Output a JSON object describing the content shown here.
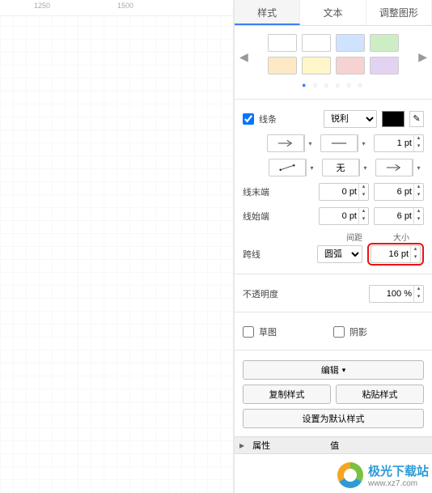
{
  "canvas": {
    "ruler_marks": [
      "1250",
      "1500"
    ]
  },
  "tabs": {
    "style": "样式",
    "text": "文本",
    "adjust": "调整图形",
    "active": "样式"
  },
  "swatches": {
    "row1": [
      "#ffffff",
      "#ffffff",
      "#cfe3ff",
      "#cdeec5"
    ],
    "row2": [
      "#fde9c4",
      "#fff6c9",
      "#f7d2d2",
      "#e3d3f2"
    ]
  },
  "line": {
    "label": "线条",
    "sharp": "锐利",
    "width_value": "1 pt",
    "style_none": "无"
  },
  "line_end": {
    "label": "线末端",
    "val1": "0 pt",
    "val2": "6 pt"
  },
  "line_start": {
    "label": "线始端",
    "val1": "0 pt",
    "val2": "6 pt"
  },
  "spacing_size": {
    "spacing": "间距",
    "size": "大小"
  },
  "cross_line": {
    "label": "跨线",
    "arc": "圆弧",
    "size": "16 pt"
  },
  "opacity": {
    "label": "不透明度",
    "value": "100 %"
  },
  "sketch": {
    "label": "草图"
  },
  "shadow": {
    "label": "阴影"
  },
  "edit": {
    "edit_btn": "编辑",
    "copy_style": "复制样式",
    "paste_style": "粘贴样式",
    "set_default": "设置为默认样式"
  },
  "props": {
    "attr": "属性",
    "value": "值"
  },
  "watermark": {
    "title": "极光下载站",
    "url": "www.xz7.com"
  }
}
